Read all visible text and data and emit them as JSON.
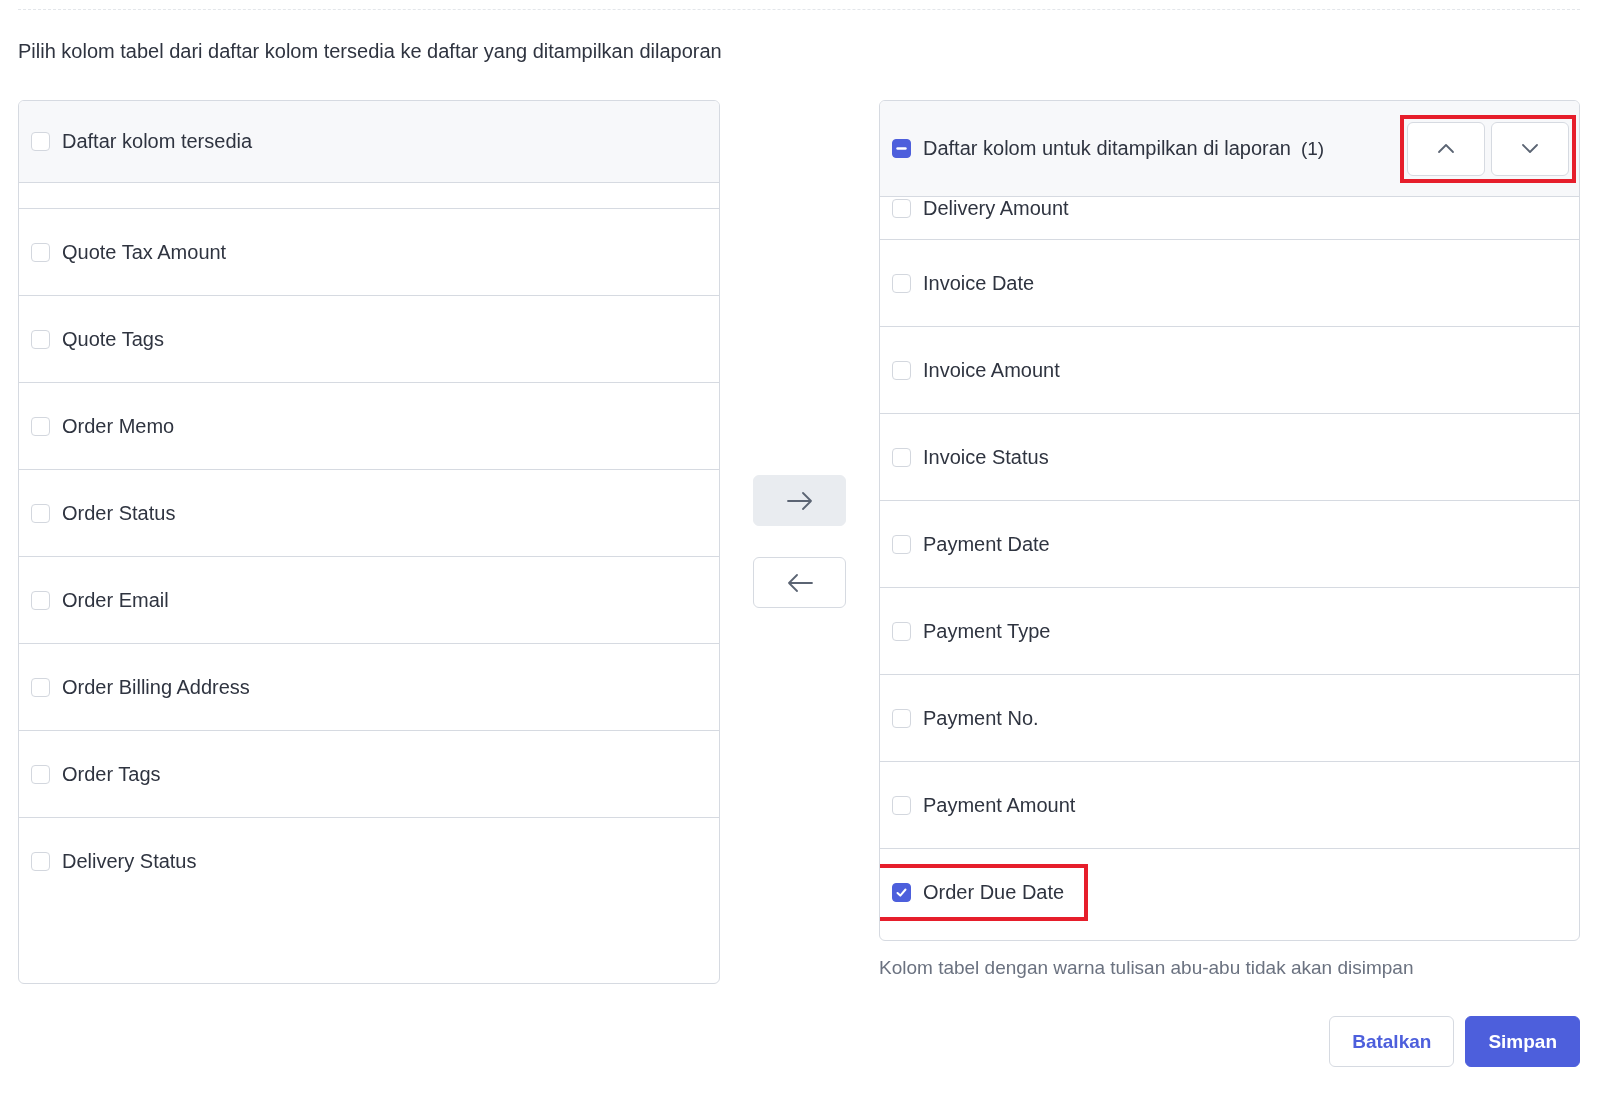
{
  "instruction": "Pilih kolom tabel dari daftar kolom tersedia ke daftar yang ditampilkan dilaporan",
  "available": {
    "title": "Daftar kolom tersedia",
    "checked": false,
    "indeterminate": false,
    "items": [
      {
        "label": "Quote Tax Amount",
        "checked": false
      },
      {
        "label": "Quote Tags",
        "checked": false
      },
      {
        "label": "Order Memo",
        "checked": false
      },
      {
        "label": "Order Status",
        "checked": false
      },
      {
        "label": "Order Email",
        "checked": false
      },
      {
        "label": "Order Billing Address",
        "checked": false
      },
      {
        "label": "Order Tags",
        "checked": false
      },
      {
        "label": "Delivery Status",
        "checked": false
      }
    ]
  },
  "move_buttons": [
    {
      "kind": "right",
      "disabled": true
    },
    {
      "kind": "left",
      "disabled": false
    }
  ],
  "shown": {
    "title": "Daftar kolom untuk ditampilkan di laporan",
    "count": "(1)",
    "indeterminate": true,
    "reorder_highlighted": true,
    "items": [
      {
        "label": "Delivery Amount",
        "checked": false,
        "highlighted": false
      },
      {
        "label": "Invoice Date",
        "checked": false,
        "highlighted": false
      },
      {
        "label": "Invoice Amount",
        "checked": false,
        "highlighted": false
      },
      {
        "label": "Invoice Status",
        "checked": false,
        "highlighted": false
      },
      {
        "label": "Payment Date",
        "checked": false,
        "highlighted": false
      },
      {
        "label": "Payment Type",
        "checked": false,
        "highlighted": false
      },
      {
        "label": "Payment No.",
        "checked": false,
        "highlighted": false
      },
      {
        "label": "Payment Amount",
        "checked": false,
        "highlighted": false
      },
      {
        "label": "Order Due Date",
        "checked": true,
        "highlighted": true
      }
    ]
  },
  "note": "Kolom tabel dengan warna tulisan abu-abu tidak akan disimpan",
  "buttons": [
    {
      "label": "Batalkan",
      "kind": "secondary"
    },
    {
      "label": "Simpan",
      "kind": "primary"
    }
  ]
}
